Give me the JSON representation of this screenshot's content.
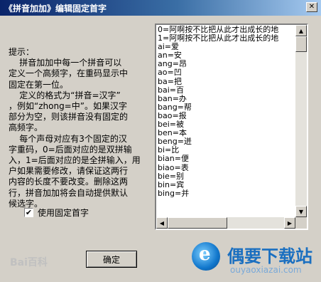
{
  "window": {
    "title": "《拼音加加》编辑固定首字"
  },
  "help_lines": [
    "提示：",
    "    拼音加加中每一个拼音可以",
    "定义一个高频字，在重码显示中",
    "固定在第一位。",
    "    定义的格式为“拼音=汉字”",
    "，例如“zhong=中”。如果汉字",
    "部分为空，则该拼音没有固定的",
    "高频字。",
    "    每个声母对应有3个固定的汉",
    "字重码，0=后面对应的是双拼输",
    "入，1=后面对应的是全拼输入，用",
    "户如果需要修改，请保证这两行",
    "内容的长度不要改变。删除这两",
    "行，拼音加加将会自动提供默认",
    "候选字。"
  ],
  "checkbox": {
    "label": "使用固定首字",
    "checked": true
  },
  "list_items": [
    "0=阿啊按不比把从此才出成长的地",
    "1=阿啊按不比把从此才出成长的地",
    "ai=爱",
    "an=安",
    "ang=昂",
    "ao=凹",
    "ba=把",
    "bai=百",
    "ban=办",
    "bang=帮",
    "bao=报",
    "bei=被",
    "ben=本",
    "beng=迸",
    "bi=比",
    "bian=便",
    "biao=表",
    "bie=别",
    "bin=宾",
    "bing=并"
  ],
  "buttons": {
    "ok": "确定"
  },
  "watermark": {
    "baidu": "Bai百科",
    "site_name": "偶要下载站",
    "site_url": "ouyaoxiazai.com"
  },
  "icons": {
    "close": "close-icon",
    "check": "check-icon",
    "scroll_up": "arrow-up-icon",
    "scroll_down": "arrow-down-icon",
    "scroll_left": "arrow-left-icon",
    "scroll_right": "arrow-right-icon"
  },
  "colors": {
    "title_bar": "#0a246a",
    "dialog_bg": "#d4d0c8"
  }
}
